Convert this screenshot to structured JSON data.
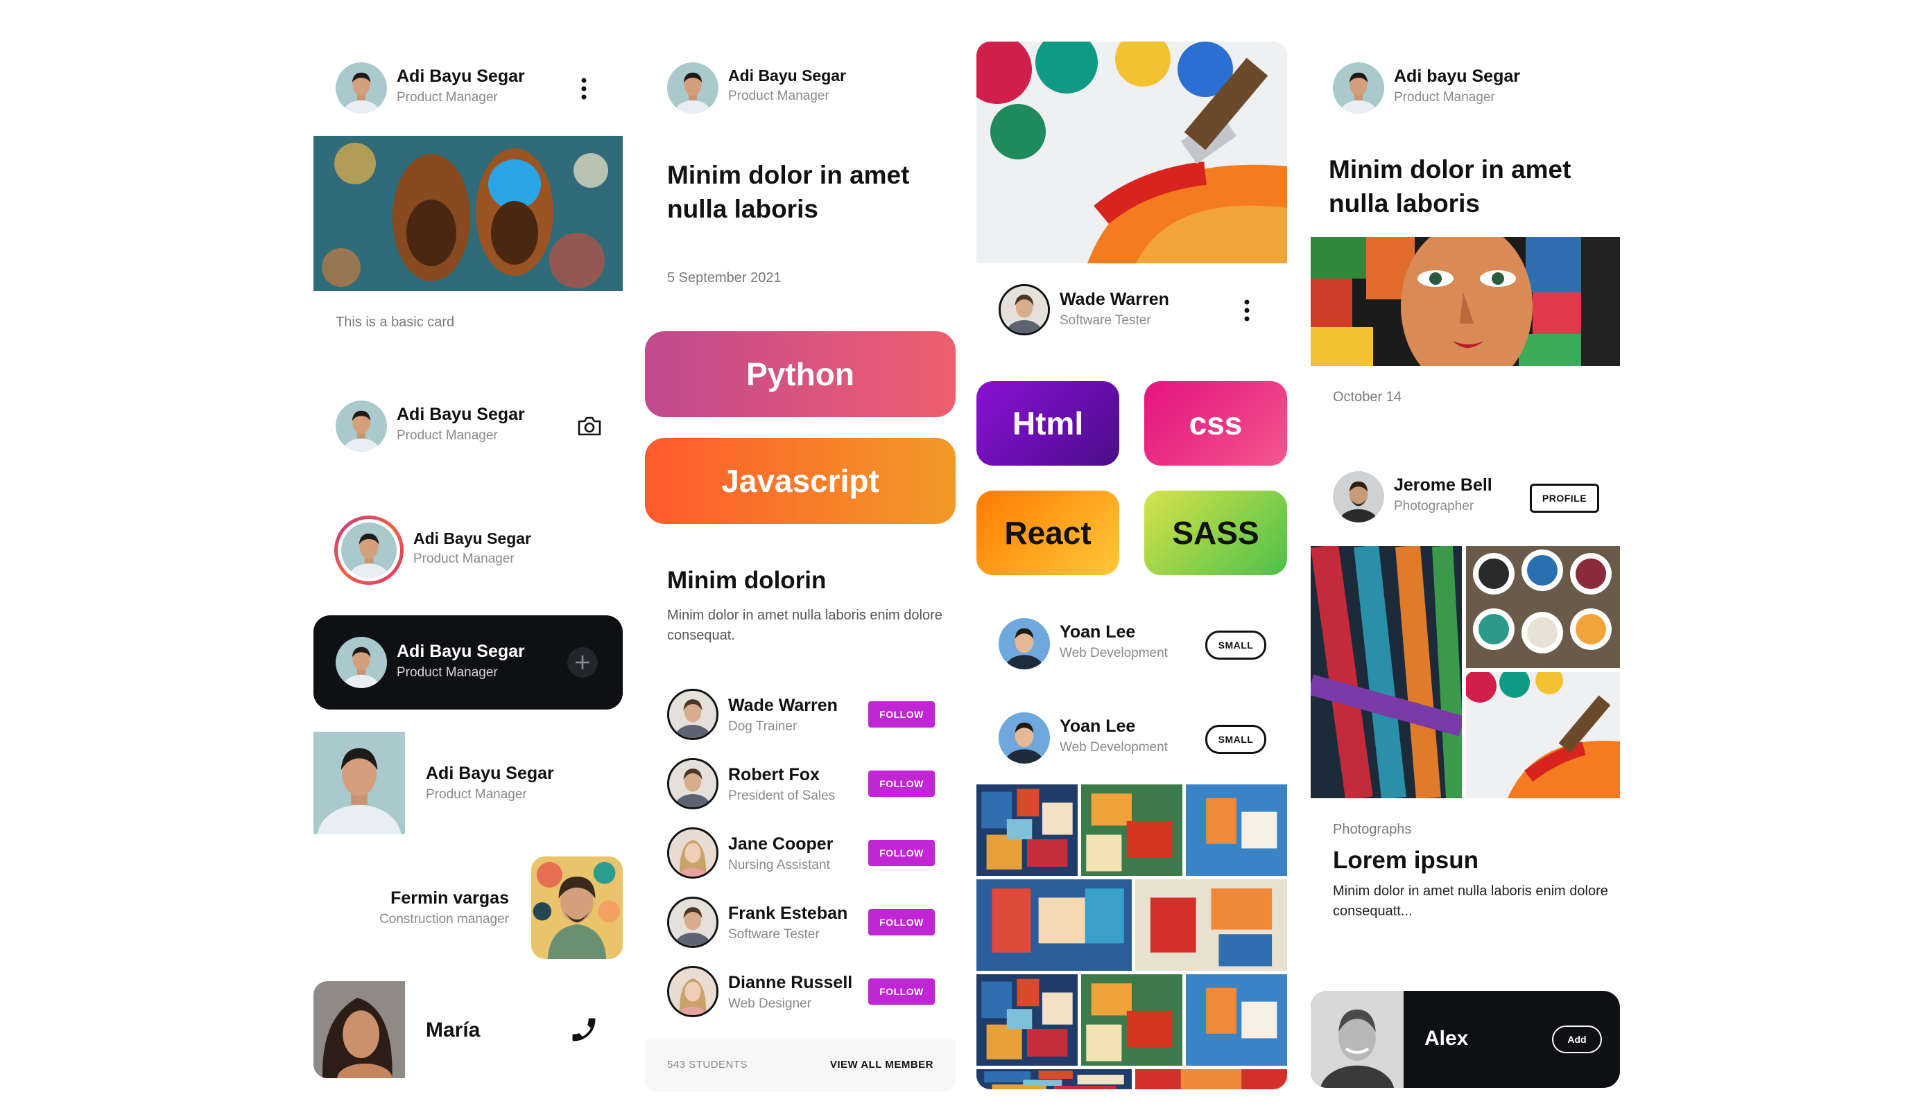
{
  "col1": {
    "card1": {
      "name": "Adi Bayu Segar",
      "role": "Product Manager",
      "caption": "This is a basic card",
      "menu_icon": "more-vert-icon"
    },
    "card2": {
      "name": "Adi Bayu Segar",
      "role": "Product Manager",
      "icon": "camera-icon"
    },
    "card3": {
      "name": "Adi Bayu Segar",
      "role": "Product Manager",
      "ring_color": "#e1306c"
    },
    "card4": {
      "name": "Adi Bayu Segar",
      "role": "Product Manager",
      "icon": "plus-icon"
    },
    "card5": {
      "name": "Adi Bayu Segar",
      "role": "Product Manager"
    },
    "card6": {
      "name": "Fermin vargas",
      "role": "Construction manager"
    },
    "card7": {
      "name": "María",
      "icon": "phone-icon"
    }
  },
  "col2": {
    "profile": {
      "name": "Adi Bayu Segar",
      "role": "Product Manager"
    },
    "headline": "Minim dolor in amet nulla laboris",
    "date": "5 September 2021",
    "pills": [
      {
        "label": "Python",
        "from": "#c2498f",
        "to": "#ee5e6f"
      },
      {
        "label": "Javascript",
        "from": "#ff5a2c",
        "to": "#f19a27"
      }
    ],
    "section_title": "Minim dolorin",
    "section_text": "Minim dolor in amet nulla laboris enim dolore consequat.",
    "members": [
      {
        "name": "Wade Warren",
        "role": "Dog Trainer",
        "button": "FOLLOW"
      },
      {
        "name": "Robert Fox",
        "role": "President of Sales",
        "button": "FOLLOW"
      },
      {
        "name": "Jane Cooper",
        "role": "Nursing Assistant",
        "button": "FOLLOW"
      },
      {
        "name": "Frank Esteban",
        "role": "Software Tester",
        "button": "FOLLOW"
      },
      {
        "name": "Dianne Russell",
        "role": "Web Designer",
        "button": "FOLLOW"
      }
    ],
    "footer": {
      "count": "543 STUDENTS",
      "link": "VIEW ALL MEMBER"
    },
    "accent": "#c026d3"
  },
  "col3": {
    "profile": {
      "name": "Wade Warren",
      "role": "Software Tester",
      "menu_icon": "more-vert-icon"
    },
    "tiles": [
      {
        "label": "Html",
        "from": "#8a11d6",
        "to": "#4b0d8a",
        "text": "#ffffff"
      },
      {
        "label": "css",
        "from": "#e6137f",
        "to": "#f2568e",
        "text": "#ffffff"
      },
      {
        "label": "React",
        "from": "#ff7a00",
        "to": "#ffc93a",
        "text": "#111111"
      },
      {
        "label": "SASS",
        "from": "#d8e34a",
        "to": "#4cc04a",
        "text": "#111111"
      }
    ],
    "small_cards": [
      {
        "name": "Yoan Lee",
        "role": "Web Development",
        "button": "SMALL"
      },
      {
        "name": "Yoan Lee",
        "role": "Web Development",
        "button": "SMALL"
      }
    ]
  },
  "col4": {
    "profile": {
      "name": "Adi bayu Segar",
      "role": "Product Manager"
    },
    "headline": "Minim dolor in amet nulla laboris",
    "date": "October 14",
    "photographer": {
      "name": "Jerome Bell",
      "role": "Photographer",
      "button": "PROFILE"
    },
    "category": "Photographs",
    "title": "Lorem ipsun",
    "text": "Minim dolor in amet nulla laboris enim dolore consequatt...",
    "alex": {
      "name": "Alex",
      "button": "Add"
    }
  }
}
